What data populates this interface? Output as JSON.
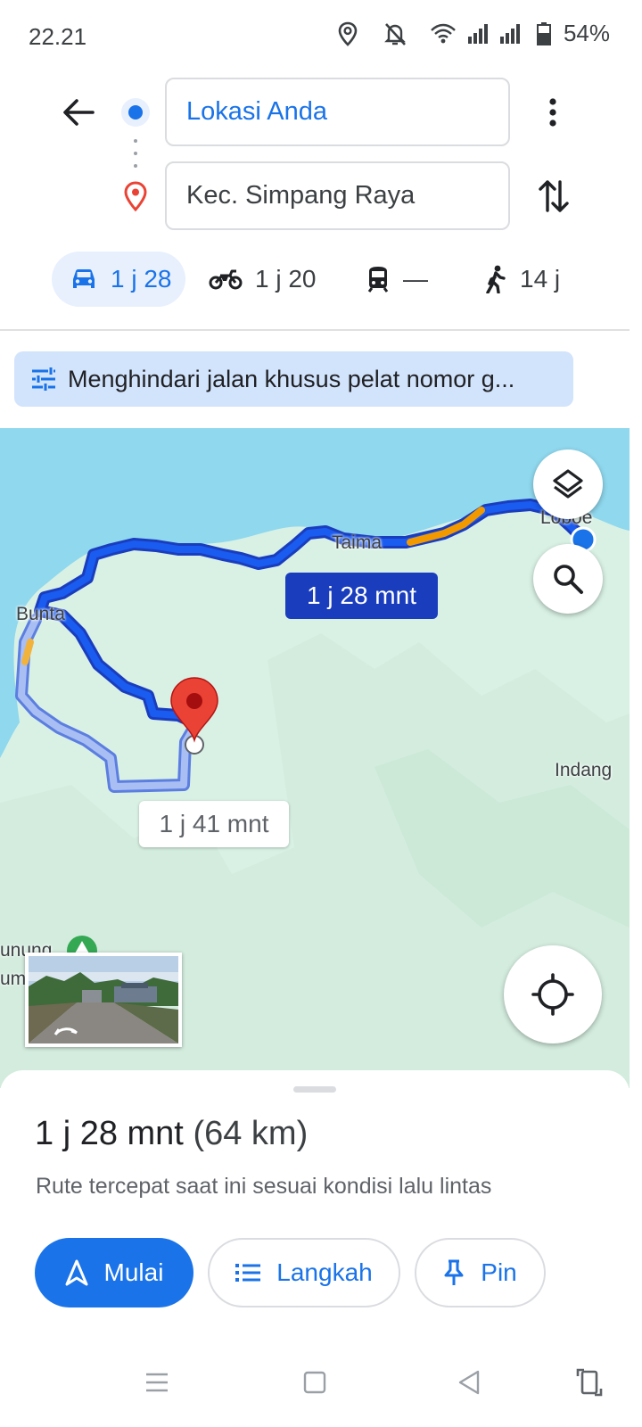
{
  "status_bar": {
    "time": "22.21",
    "battery": "54%",
    "icons": [
      "location-icon",
      "silent-icon",
      "wifi-icon",
      "signal-icon",
      "signal-icon",
      "battery-icon"
    ]
  },
  "header": {
    "origin": "Lokasi Anda",
    "destination": "Kec. Simpang Raya",
    "icons": [
      "back-arrow-icon",
      "origin-dot-icon",
      "destination-pin-icon",
      "more-vert-icon",
      "swap-icon"
    ]
  },
  "modes": [
    {
      "name": "car",
      "icon": "car-icon",
      "label": "1 j 28",
      "selected": true
    },
    {
      "name": "motorcycle",
      "icon": "motorcycle-icon",
      "label": "1 j 20",
      "selected": false
    },
    {
      "name": "transit",
      "icon": "train-icon",
      "label": "—",
      "selected": false
    },
    {
      "name": "walk",
      "icon": "walk-icon",
      "label": "14 j",
      "selected": false
    }
  ],
  "options_chip": {
    "icon": "tune-icon",
    "text": "Menghindari jalan khusus pelat nomor g..."
  },
  "map": {
    "places": [
      "Taima",
      "Loboe",
      "Bunta",
      "Indang",
      "unung",
      "um"
    ],
    "primary_route_label": "1 j 28 mnt",
    "alternate_route_label": "1 j 41 mnt",
    "colors": {
      "water": "#8fd8ee",
      "land": "#d9f1e5",
      "primary_route": "#1a3dbd",
      "alternate_route": "#9db4f0",
      "traffic": "#f29900",
      "pin": "#ea4335"
    },
    "icons": [
      "layers-icon",
      "search-icon",
      "my-location-icon",
      "street-view-icon",
      "destination-pin-icon"
    ]
  },
  "sheet": {
    "duration": "1 j 28 mnt",
    "distance": "(64 km)",
    "description": "Rute tercepat saat ini sesuai kondisi lalu lintas",
    "buttons": {
      "start": "Mulai",
      "steps": "Langkah",
      "pin": "Pin"
    }
  },
  "navbar": {
    "icons": [
      "menu-icon",
      "home-icon",
      "back-icon",
      "rotate-icon"
    ]
  }
}
